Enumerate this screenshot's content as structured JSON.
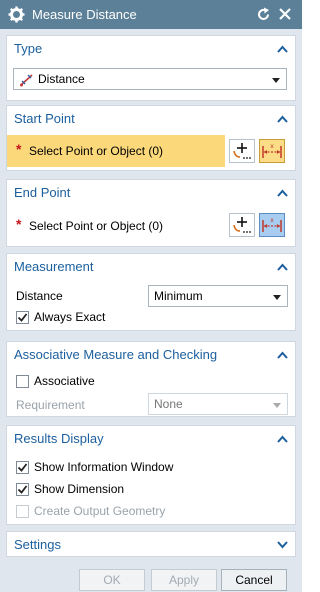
{
  "window": {
    "title": "Measure Distance",
    "title_bar_color": "#5c8098"
  },
  "sections": {
    "type": {
      "title": "Type",
      "selected": "Distance"
    },
    "start_point": {
      "title": "Start Point",
      "prompt": "Select Point or Object (0)",
      "required_marker": "*"
    },
    "end_point": {
      "title": "End Point",
      "prompt": "Select Point or Object (0)",
      "required_marker": "*"
    },
    "measurement": {
      "title": "Measurement",
      "distance_label": "Distance",
      "distance_value": "Minimum",
      "always_exact_label": "Always Exact",
      "always_exact_checked": true
    },
    "associative": {
      "title": "Associative Measure and Checking",
      "associative_label": "Associative",
      "associative_checked": false,
      "requirement_label": "Requirement",
      "requirement_value": "None"
    },
    "results_display": {
      "title": "Results Display",
      "show_info_window_label": "Show Information Window",
      "show_info_window_checked": true,
      "show_dimension_label": "Show Dimension",
      "show_dimension_checked": true,
      "create_output_label": "Create Output Geometry",
      "create_output_checked": false
    },
    "settings": {
      "title": "Settings"
    }
  },
  "buttons": {
    "ok": "OK",
    "apply": "Apply",
    "cancel": "Cancel"
  },
  "colors": {
    "section_title": "#1b5f9e",
    "active_selection": "#fbd97a",
    "required_star": "#c4161c"
  },
  "icons": {
    "title": "gear-icon",
    "reset": "reset-icon",
    "close": "close-icon",
    "type": "distance-ruler-icon",
    "point_constructor": "point-dialog-icon",
    "measure": "measure-distance-icon"
  }
}
